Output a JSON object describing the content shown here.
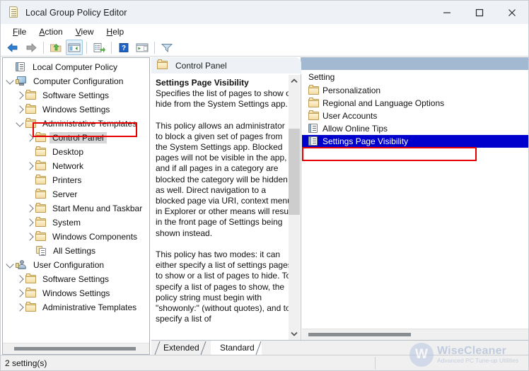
{
  "window": {
    "title": "Local Group Policy Editor",
    "icon": "policy-document-icon",
    "minimize": "—",
    "maximize": "□",
    "close": "✕"
  },
  "menubar": {
    "items": [
      {
        "label": "File",
        "accel": "F"
      },
      {
        "label": "Action",
        "accel": "A"
      },
      {
        "label": "View",
        "accel": "V"
      },
      {
        "label": "Help",
        "accel": "H"
      }
    ]
  },
  "toolbar": {
    "buttons": [
      {
        "name": "back-icon",
        "title": "Back"
      },
      {
        "name": "forward-icon",
        "title": "Forward"
      },
      {
        "name": "up-one-level-icon",
        "title": "Up one level"
      },
      {
        "name": "show-hide-console-tree-icon",
        "title": "Show/Hide Console Tree",
        "active": true
      },
      {
        "name": "export-list-icon",
        "title": "Export List"
      },
      {
        "name": "help-icon",
        "title": "Help"
      },
      {
        "name": "show-hide-action-pane-icon",
        "title": "Show/Hide Action Pane"
      },
      {
        "name": "filter-icon",
        "title": "Filter"
      }
    ]
  },
  "tree": {
    "items": [
      {
        "label": "Local Computer Policy",
        "indent": 0,
        "twisty": "",
        "icon": "policy-document-icon",
        "selected": false
      },
      {
        "label": "Computer Configuration",
        "indent": 0,
        "twisty": "down",
        "icon": "computer-icon",
        "selected": false
      },
      {
        "label": "Software Settings",
        "indent": 1,
        "twisty": "right",
        "icon": "folder-icon",
        "selected": false
      },
      {
        "label": "Windows Settings",
        "indent": 1,
        "twisty": "right",
        "icon": "folder-icon",
        "selected": false
      },
      {
        "label": "Administrative Templates",
        "indent": 1,
        "twisty": "down",
        "icon": "folder-icon",
        "selected": false
      },
      {
        "label": "Control Panel",
        "indent": 2,
        "twisty": "right",
        "icon": "folder-icon",
        "selected": true
      },
      {
        "label": "Desktop",
        "indent": 2,
        "twisty": "",
        "icon": "folder-icon",
        "selected": false
      },
      {
        "label": "Network",
        "indent": 2,
        "twisty": "right",
        "icon": "folder-icon",
        "selected": false
      },
      {
        "label": "Printers",
        "indent": 2,
        "twisty": "",
        "icon": "folder-icon",
        "selected": false
      },
      {
        "label": "Server",
        "indent": 2,
        "twisty": "",
        "icon": "folder-icon",
        "selected": false
      },
      {
        "label": "Start Menu and Taskbar",
        "indent": 2,
        "twisty": "right",
        "icon": "folder-icon",
        "selected": false
      },
      {
        "label": "System",
        "indent": 2,
        "twisty": "right",
        "icon": "folder-icon",
        "selected": false
      },
      {
        "label": "Windows Components",
        "indent": 2,
        "twisty": "right",
        "icon": "folder-icon",
        "selected": false
      },
      {
        "label": "All Settings",
        "indent": 2,
        "twisty": "",
        "icon": "all-settings-icon",
        "selected": false
      },
      {
        "label": "User Configuration",
        "indent": 0,
        "twisty": "down",
        "icon": "user-icon",
        "selected": false
      },
      {
        "label": "Software Settings",
        "indent": 1,
        "twisty": "right",
        "icon": "folder-icon",
        "selected": false
      },
      {
        "label": "Windows Settings",
        "indent": 1,
        "twisty": "right",
        "icon": "folder-icon",
        "selected": false
      },
      {
        "label": "Administrative Templates",
        "indent": 1,
        "twisty": "right",
        "icon": "folder-icon",
        "selected": false
      }
    ]
  },
  "details": {
    "header_label": "Control Panel",
    "header_icon": "folder-icon",
    "policy_title": "Settings Page Visibility",
    "policy_body": "Specifies the list of pages to show or hide from the System Settings app.\n\nThis policy allows an administrator to block a given set of pages from the System Settings app. Blocked pages will not be visible in the app, and if all pages in a category are blocked the category will be hidden as well. Direct navigation to a blocked page via URI, context menu in Explorer or other means will result in the front page of Settings being shown instead.\n\nThis policy has two modes: it can either specify a list of settings pages to show or a list of pages to hide. To specify a list of pages to show, the policy string must begin with \"showonly:\" (without quotes), and to specify a list of"
  },
  "tabs": [
    {
      "label": "Extended",
      "selected": false
    },
    {
      "label": "Standard",
      "selected": true
    }
  ],
  "settings_list": {
    "column_header": "Setting",
    "rows": [
      {
        "label": "Personalization",
        "icon": "folder-icon",
        "selected": false
      },
      {
        "label": "Regional and Language Options",
        "icon": "folder-icon",
        "selected": false
      },
      {
        "label": "User Accounts",
        "icon": "folder-icon",
        "selected": false
      },
      {
        "label": "Allow Online Tips",
        "icon": "policy-setting-icon",
        "selected": false
      },
      {
        "label": "Settings Page Visibility",
        "icon": "policy-setting-icon",
        "selected": true
      }
    ]
  },
  "statusbar": {
    "text": "2 setting(s)"
  },
  "watermark": {
    "mark": "W",
    "name": "WiseCleaner",
    "tagline": "Advanced PC Tune-up Utilities"
  },
  "highlights": [
    {
      "name": "tree-control-panel-highlight",
      "color": "#e60000"
    },
    {
      "name": "settings-page-visibility-highlight",
      "color": "#e60000"
    }
  ],
  "colors": {
    "selection_blue": "#0000cc",
    "header_band": "#a3b9d2",
    "highlight_red": "#e60000",
    "titlebar": "#eef1f6"
  }
}
